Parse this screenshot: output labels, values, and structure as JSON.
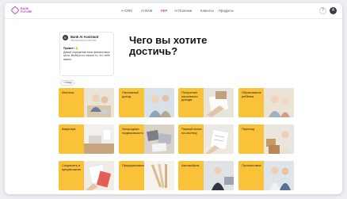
{
  "logo": {
    "line1": "BANK",
    "line2": "FUTURE"
  },
  "nav": {
    "items": [
      {
        "label": "A-CRM",
        "active": false
      },
      {
        "label": "AI BAM",
        "active": false
      },
      {
        "label": "FEP",
        "active": true
      },
      {
        "label": "AI Платежи",
        "active": false
      },
      {
        "label": "Клиенты",
        "active": false
      },
      {
        "label": "Продукты",
        "active": false
      }
    ],
    "help_glyph": "?",
    "avatar_glyph": "A"
  },
  "assistant": {
    "avatar_glyph": "B",
    "name": "Bank AI Assistant",
    "subtitle": "Финансовый советник",
    "greeting": "Привет! 👋",
    "message": "Давай определим твои финансовые цели. Выбери из списка то, что тебе важно."
  },
  "back_button": {
    "label": "‹ Назад"
  },
  "heading": "Чего вы хотите достичь?",
  "tiles": [
    {
      "label": "Ипотека"
    },
    {
      "label": "Пассивный доход"
    },
    {
      "label": "Получение пассивного дохода"
    },
    {
      "label": "Образование ребёнка"
    },
    {
      "label": "Квартира"
    },
    {
      "label": "Загородная недвижимость"
    },
    {
      "label": "Первый взнос на ипотеку"
    },
    {
      "label": "Переезд"
    },
    {
      "label": "Сохранить и преумножить"
    },
    {
      "label": "Предпринимательство"
    },
    {
      "label": "Автомобиль"
    },
    {
      "label": "Путешествие"
    }
  ],
  "colors": {
    "accent": "#c04ac6",
    "tile": "#f9c238"
  }
}
